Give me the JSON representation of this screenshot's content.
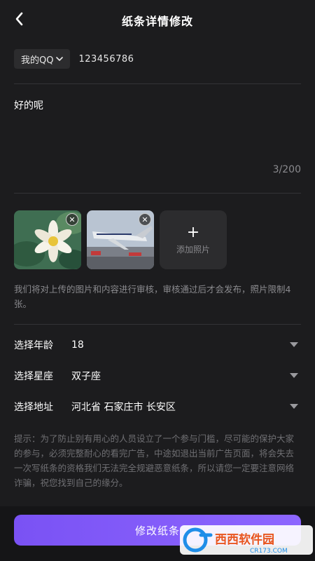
{
  "header": {
    "title": "纸条详情修改"
  },
  "contact": {
    "type_label": "我的QQ",
    "number": "123456786"
  },
  "note": {
    "text": "好的呢",
    "count": "3/200"
  },
  "photos": {
    "add_label": "添加照片",
    "close_symbol": "✕",
    "add_symbol": "+"
  },
  "review_note": "我们将对上传的图片和内容进行审核，审核通过后才会发布，照片限制4张。",
  "fields": [
    {
      "label": "选择年龄",
      "value": "18"
    },
    {
      "label": "选择星座",
      "value": "双子座"
    },
    {
      "label": "选择地址",
      "value": "河北省 石家庄市 长安区"
    }
  ],
  "tips": "提示：为了防止别有用心的人员设立了一个参与门槛，尽可能的保护大家的参与，必须完整耐心的看完广告，中途如退出当前广告页面，将会失去一次写纸条的资格我们无法完全规避恶意纸条，所以请您一定要注意网络诈骗，祝您找到自己的缘分。",
  "submit_label": "修改纸条",
  "watermark": {
    "text": "西西软件园",
    "url": "CR173.COM"
  },
  "colors": {
    "accent": "#7a52f4",
    "background": "#1c1c1e",
    "muted_text": "#8a8a8e"
  },
  "icons": {
    "back": "chevron-left-icon",
    "dropdown": "chevron-down-icon",
    "field_arrow": "caret-down-icon"
  }
}
